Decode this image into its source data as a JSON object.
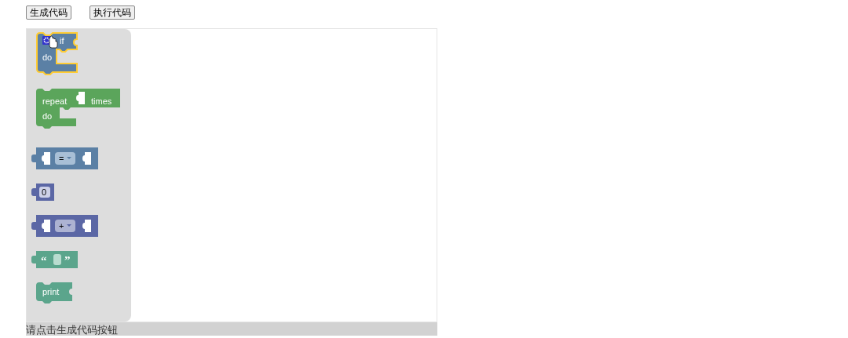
{
  "buttons": [
    {
      "label": "生成代码"
    },
    {
      "label": "执行代码"
    }
  ],
  "flyout": {
    "blocks": [
      {
        "kind": "if",
        "selected": true,
        "labels": [
          "if",
          "do"
        ]
      },
      {
        "kind": "repeat",
        "selected": false,
        "labels": [
          "repeat",
          "times",
          "do"
        ]
      },
      {
        "kind": "compare",
        "selected": false,
        "labels": [
          "="
        ]
      },
      {
        "kind": "number",
        "selected": false,
        "labels": [
          "0"
        ]
      },
      {
        "kind": "arithmetic",
        "selected": false,
        "labels": [
          "+"
        ]
      },
      {
        "kind": "text",
        "selected": false,
        "labels": [
          "“",
          "”"
        ]
      },
      {
        "kind": "print",
        "selected": false,
        "labels": [
          "print"
        ]
      }
    ]
  },
  "status_bar": {
    "text": "请点击生成代码按钮"
  }
}
